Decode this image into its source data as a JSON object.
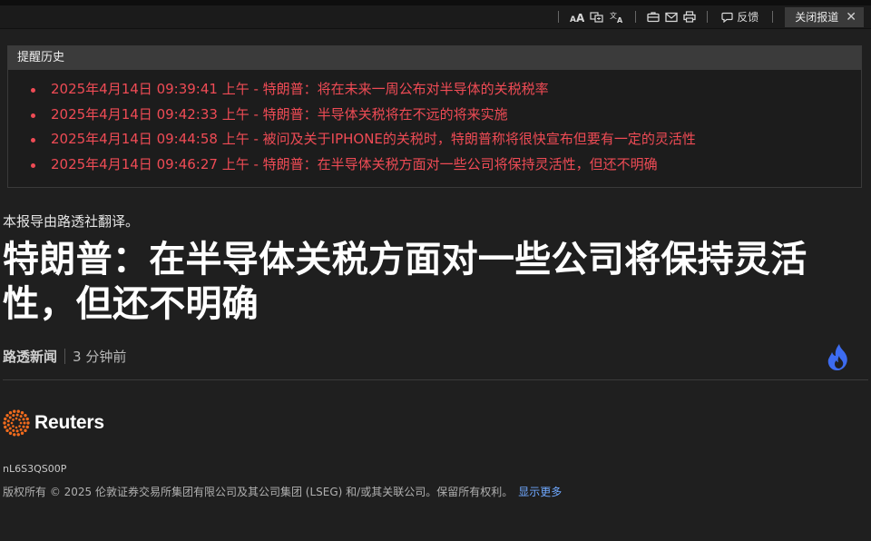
{
  "toolbar": {
    "feedback_label": "反馈",
    "close_report_label": "关闭报道"
  },
  "alerts": {
    "title": "提醒历史",
    "items": [
      "2025年4月14日 09:39:41 上午 - 特朗普：将在未来一周公布对半导体的关税税率",
      "2025年4月14日 09:42:33 上午 - 特朗普：半导体关税将在不远的将来实施",
      "2025年4月14日 09:44:58 上午 - 被问及关于IPHONE的关税时，特朗普称将很快宣布但要有一定的灵活性",
      "2025年4月14日 09:46:27 上午 - 特朗普：在半导体关税方面对一些公司将保持灵活性，但还不明确"
    ],
    "color": "#ef4b55"
  },
  "article": {
    "translation_note": "本报导由路透社翻译。",
    "headline": "特朗普：在半导体关税方面对一些公司将保持灵活性，但还不明确",
    "source": "路透新闻",
    "time_ago": "3 分钟前",
    "hot_icon_color": "#3d6cf0"
  },
  "footer": {
    "logo_text": "Reuters",
    "logo_color": "#f26b1d",
    "story_id": "nL6S3QS00P",
    "copyright": "版权所有 © 2025 伦敦证券交易所集团有限公司及其公司集团 (LSEG) 和/或其关联公司。保留所有权利。",
    "more_link": "显示更多",
    "link_color": "#6fa8ff"
  },
  "icons": [
    "font-size-icon",
    "translate-pages-icon",
    "translate-icon",
    "briefcase-icon",
    "mail-icon",
    "print-icon",
    "feedback-icon",
    "close-icon",
    "flame-icon",
    "reuters-logo-icon"
  ]
}
